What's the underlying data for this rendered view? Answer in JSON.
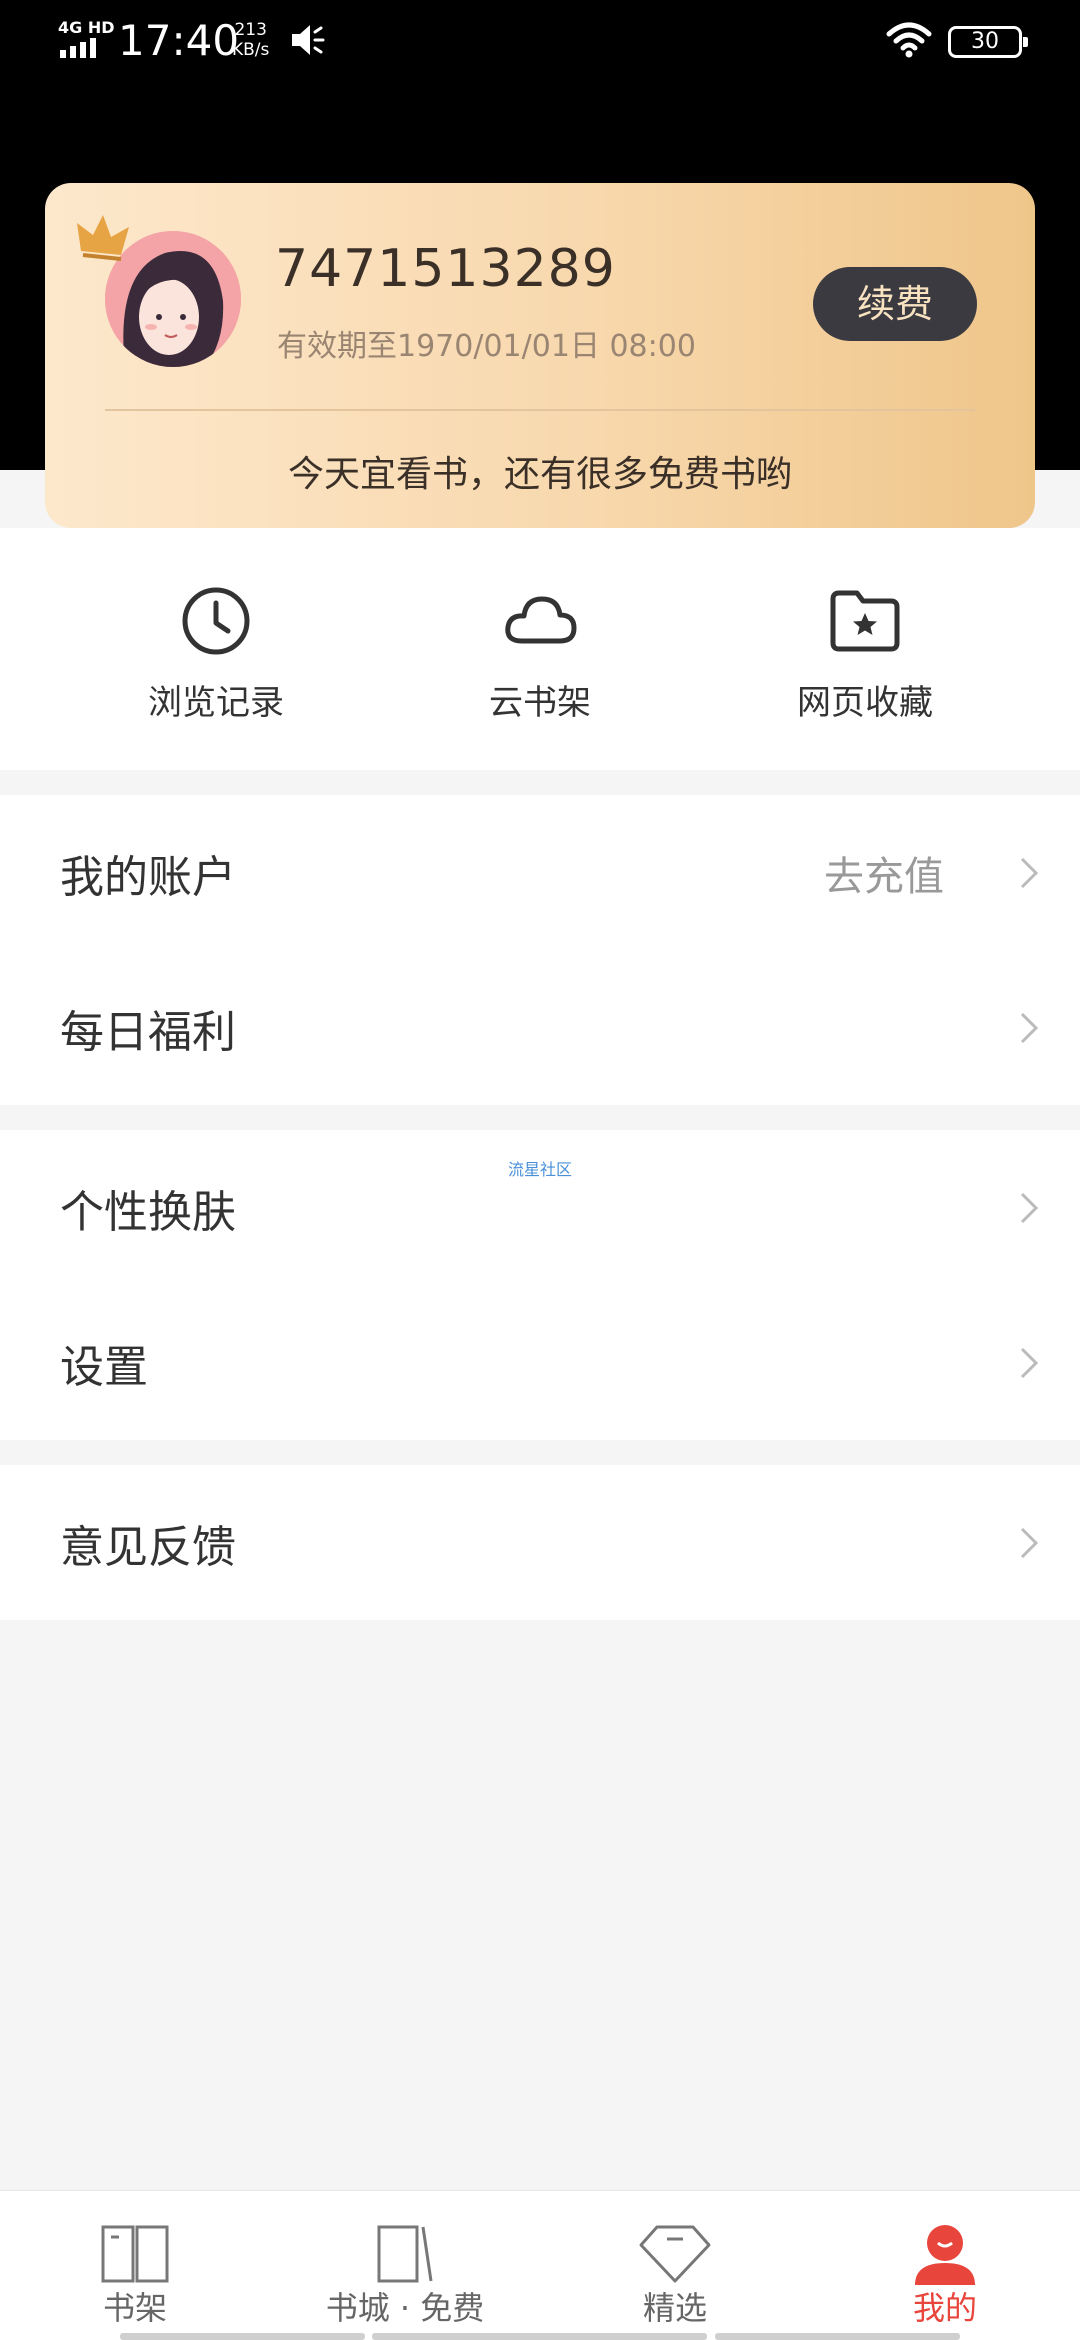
{
  "status_bar": {
    "network": "4G HD",
    "time": "17:40",
    "speed_value": "213",
    "speed_unit": "KB/s",
    "battery": "30"
  },
  "vip_card": {
    "account_id": "7471513289",
    "expiry": "有效期至1970/01/01日 08:00",
    "renew_label": "续费",
    "slogan": "今天宜看书，还有很多免费书哟"
  },
  "quick_actions": [
    {
      "label": "浏览记录",
      "icon": "clock-icon"
    },
    {
      "label": "云书架",
      "icon": "cloud-icon"
    },
    {
      "label": "网页收藏",
      "icon": "folder-star-icon"
    }
  ],
  "menu": {
    "account": {
      "label": "我的账户",
      "hint": "去充值"
    },
    "daily_bonus": {
      "label": "每日福利"
    },
    "skin": {
      "label": "个性换肤"
    },
    "settings": {
      "label": "设置"
    },
    "feedback": {
      "label": "意见反馈"
    }
  },
  "watermark": "流星社区",
  "bottom_nav": [
    {
      "label": "书架",
      "icon": "open-book-icon",
      "active": false
    },
    {
      "label": "书城 · 免费",
      "icon": "bookstore-icon",
      "active": false
    },
    {
      "label": "精选",
      "icon": "diamond-icon",
      "active": false
    },
    {
      "label": "我的",
      "icon": "profile-icon",
      "active": true
    }
  ],
  "colors": {
    "accent": "#e8453c",
    "card_gradient_start": "#fde8cc",
    "card_gradient_end": "#efc68a",
    "renew_button": "#3a3a40"
  }
}
